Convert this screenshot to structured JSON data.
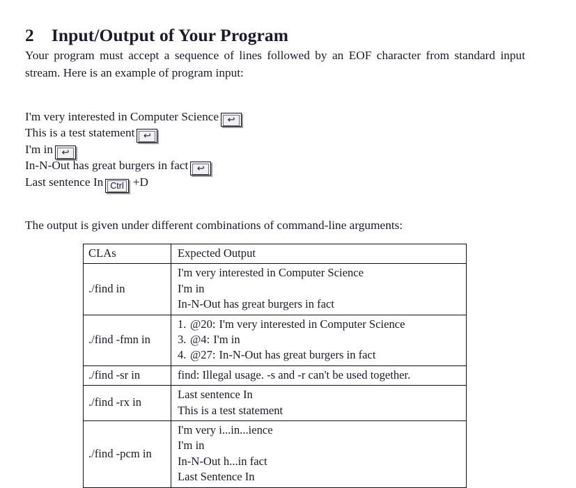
{
  "section": {
    "number": "2",
    "title": "Input/Output of Your Program"
  },
  "intro_paragraph": {
    "line1": "Your program must accept a sequence of lines followed by an EOF character from standard",
    "line2": "input stream.  Here is an example of program input:"
  },
  "sample_input": {
    "lines": [
      {
        "text": "I'm very interested in Computer Science",
        "key": "enter-key-icon",
        "key_label": "↩"
      },
      {
        "text": "This is a test statement",
        "key": "enter-key-icon",
        "key_label": "↩"
      },
      {
        "text": "I'm in",
        "key": "enter-key-icon",
        "key_label": "↩"
      },
      {
        "text": "In-N-Out has great burgers in fact",
        "key": "enter-key-icon",
        "key_label": "↩"
      },
      {
        "text": "Last sentence In",
        "key": "ctrl-key-icon",
        "key_label": "Ctrl",
        "suffix": "+D"
      }
    ]
  },
  "output_paragraph": {
    "text": "The output is given under different combinations of command-line arguments:"
  },
  "results_table": {
    "headers": {
      "cla": "CLAs",
      "output": "Expected Output"
    },
    "rows": [
      {
        "cla": "./find in",
        "output_lines": [
          "I'm very interested in Computer Science",
          "I'm in",
          "In-N-Out has great burgers in fact"
        ]
      },
      {
        "cla": "./find -fmn in",
        "numbered_lines": [
          {
            "index": "1.",
            "at": "@20:",
            "text": "I'm very interested in Computer Science"
          },
          {
            "index": "3.",
            "at": "@4:",
            "text": "I'm in"
          },
          {
            "index": "4.",
            "at": "@27:",
            "text": "In-N-Out has great burgers in fact"
          }
        ]
      },
      {
        "cla": "./find -sr in",
        "output_lines": [
          "find: Illegal usage. -s and -r can't be used together."
        ]
      },
      {
        "cla": "./find -rx in",
        "output_lines": [
          "Last sentence In",
          "This is a test statement"
        ]
      },
      {
        "cla": "./find -pcm in",
        "output_lines": [
          "I'm very i...in...ience",
          "I'm in",
          "In-N-Out h...in fact",
          "Last Sentence In"
        ]
      }
    ]
  },
  "colors": {
    "page_background": "#ffffff",
    "text": "#1b1b2a",
    "rule": "#0f0f18",
    "keycap_face": "#f1f1f1",
    "keycap_shadow": "#9a9a9a"
  }
}
